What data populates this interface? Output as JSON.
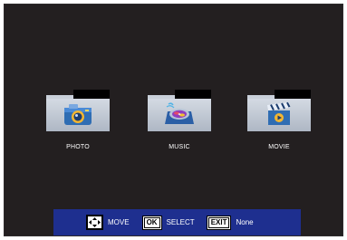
{
  "menu": {
    "items": [
      {
        "label": "PHOTO",
        "icon": "photo-camera-icon"
      },
      {
        "label": "MUSIC",
        "icon": "music-disc-icon"
      },
      {
        "label": "MOVIE",
        "icon": "movie-clapper-icon"
      }
    ]
  },
  "footer": {
    "move_label": "MOVE",
    "ok_key": "OK",
    "select_label": "SELECT",
    "exit_key": "EXIT",
    "none_label": "None"
  },
  "colors": {
    "background": "#231f20",
    "footer_bar": "#1e2f8f",
    "folder": "#c9d0da"
  }
}
